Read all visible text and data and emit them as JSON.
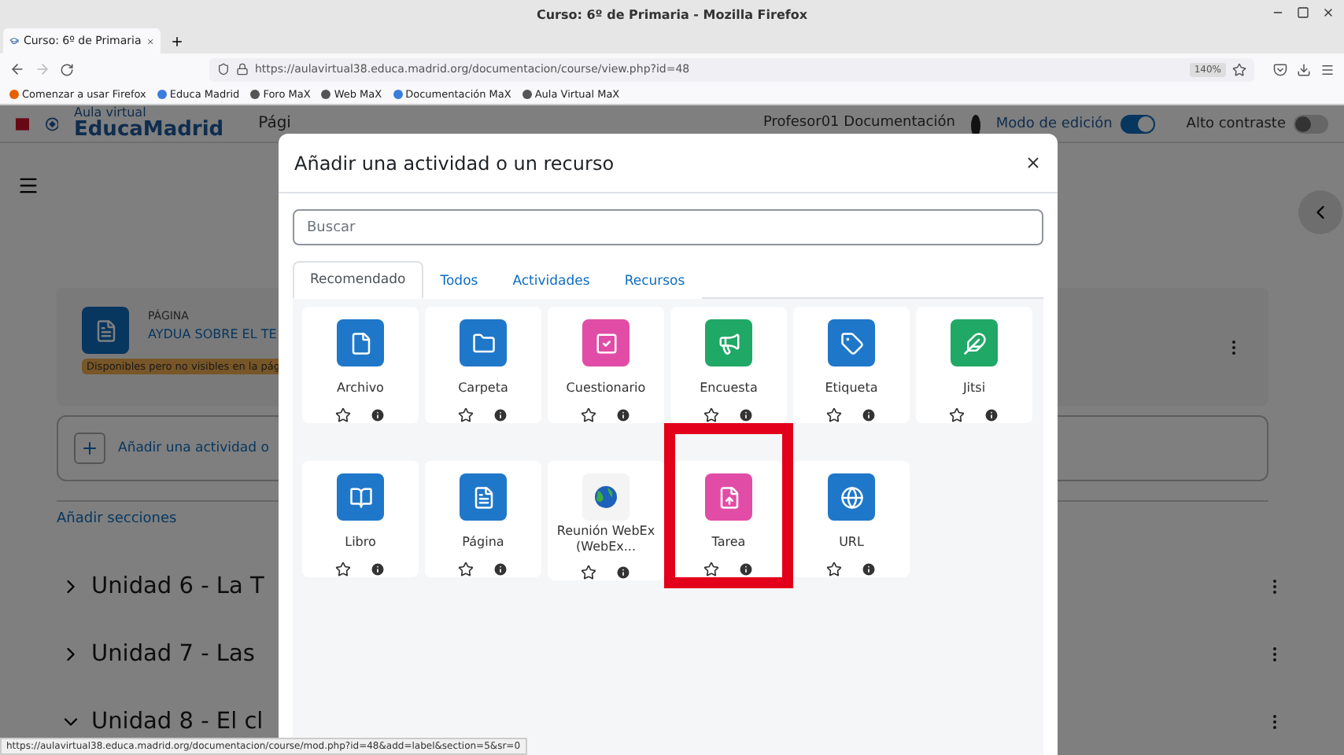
{
  "browser": {
    "window_title": "Curso: 6º de Primaria - Mozilla Firefox",
    "tab_title": "Curso: 6º de Primaria",
    "url": "https://aulavirtual38.educa.madrid.org/documentacion/course/view.php?id=48",
    "zoom": "140%",
    "bookmarks": [
      "Comenzar a usar Firefox",
      "Educa Madrid",
      "Foro MaX",
      "Web MaX",
      "Documentación MaX",
      "Aula Virtual MaX"
    ]
  },
  "page": {
    "header": {
      "logo_small": "Aula virtual",
      "logo_large": "EducaMadrid",
      "nav_link": "Pági",
      "user": "Profesor01 Documentación",
      "toggles": [
        {
          "label": "Modo de edición",
          "on": true
        },
        {
          "label": "Alto contraste",
          "on": false
        }
      ]
    },
    "activity": {
      "type_label": "PÁGINA",
      "title": "AYDUA SOBRE EL TE",
      "availability": "Disponibles pero no visibles en la pág"
    },
    "add_activity": "Añadir una actividad o",
    "add_sections": "Añadir secciones",
    "sections": [
      {
        "title": "Unidad 6 - La T",
        "expanded": false
      },
      {
        "title": "Unidad 7 - Las",
        "expanded": false
      },
      {
        "title": "Unidad 8 - El cl",
        "expanded": true
      }
    ]
  },
  "modal": {
    "title": "Añadir una actividad o un recurso",
    "search": {
      "placeholder": "Buscar"
    },
    "tabs": [
      {
        "label": "Recomendado",
        "selected": true
      },
      {
        "label": "Todos",
        "selected": false
      },
      {
        "label": "Actividades",
        "selected": false
      },
      {
        "label": "Recursos",
        "selected": false
      }
    ],
    "items": [
      {
        "label": "Archivo",
        "color": "#1f77c9",
        "highlighted": false
      },
      {
        "label": "Carpeta",
        "color": "#1f77c9",
        "highlighted": false
      },
      {
        "label": "Cuestionario",
        "color": "#e14da6",
        "highlighted": false
      },
      {
        "label": "Encuesta",
        "color": "#20a866",
        "highlighted": false
      },
      {
        "label": "Etiqueta",
        "color": "#1f77c9",
        "highlighted": false
      },
      {
        "label": "Jitsi",
        "color": "#20a866",
        "highlighted": false
      },
      {
        "label": "Libro",
        "color": "#1f77c9",
        "highlighted": false
      },
      {
        "label": "Página",
        "color": "#1f77c9",
        "highlighted": false
      },
      {
        "label": "Reunión WebEx (WebEx...",
        "color": "#f4f4f4",
        "highlighted": false
      },
      {
        "label": "Tarea",
        "color": "#e14da6",
        "highlighted": true
      },
      {
        "label": "URL",
        "color": "#1f77c9",
        "highlighted": false
      }
    ]
  },
  "status_bar": "https://aulavirtual38.educa.madrid.org/documentacion/course/mod.php?id=48&add=label&section=5&sr=0"
}
